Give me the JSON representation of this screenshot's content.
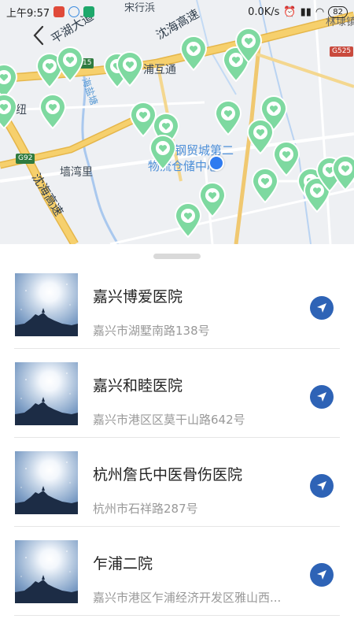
{
  "status_bar": {
    "time": "上午9:57",
    "net_speed": "0.0K/s",
    "battery": "82"
  },
  "map": {
    "labels": {
      "road_top": "平湖大道",
      "road_shenhai_top": "沈海高速",
      "road_shenhai_left": "沈海高速",
      "village_song": "宋行浜",
      "town_zhapu": "浦互通",
      "town_qiangwanli": "墙湾里",
      "poi_warehouse_line1": "钢贸城第二",
      "poi_warehouse_line2": "物流仓储中心",
      "lin_right": "林埭镇",
      "partial_left": "纽",
      "canal": "海盐塘"
    },
    "shields": {
      "g92": "G92",
      "g525": "G525",
      "s15": "15"
    }
  },
  "list": {
    "items": [
      {
        "name": "嘉兴博爱医院",
        "address": "嘉兴市湖墅南路138号"
      },
      {
        "name": "嘉兴和睦医院",
        "address": "嘉兴市港区区莫干山路642号"
      },
      {
        "name": "杭州詹氏中医骨伤医院",
        "address": "杭州市石祥路287号"
      },
      {
        "name": "乍浦二院",
        "address": "嘉兴市港区乍浦经济开发区雅山西..."
      }
    ]
  },
  "colors": {
    "pin": "#7ed9a0",
    "nav_button": "#2e63b6",
    "location_dot": "#2f7bf0",
    "highway": "#f2c55b"
  },
  "icons": {
    "pin": "heart-location-pin-icon",
    "nav": "navigation-arrow-icon",
    "back": "chevron-left-icon"
  }
}
